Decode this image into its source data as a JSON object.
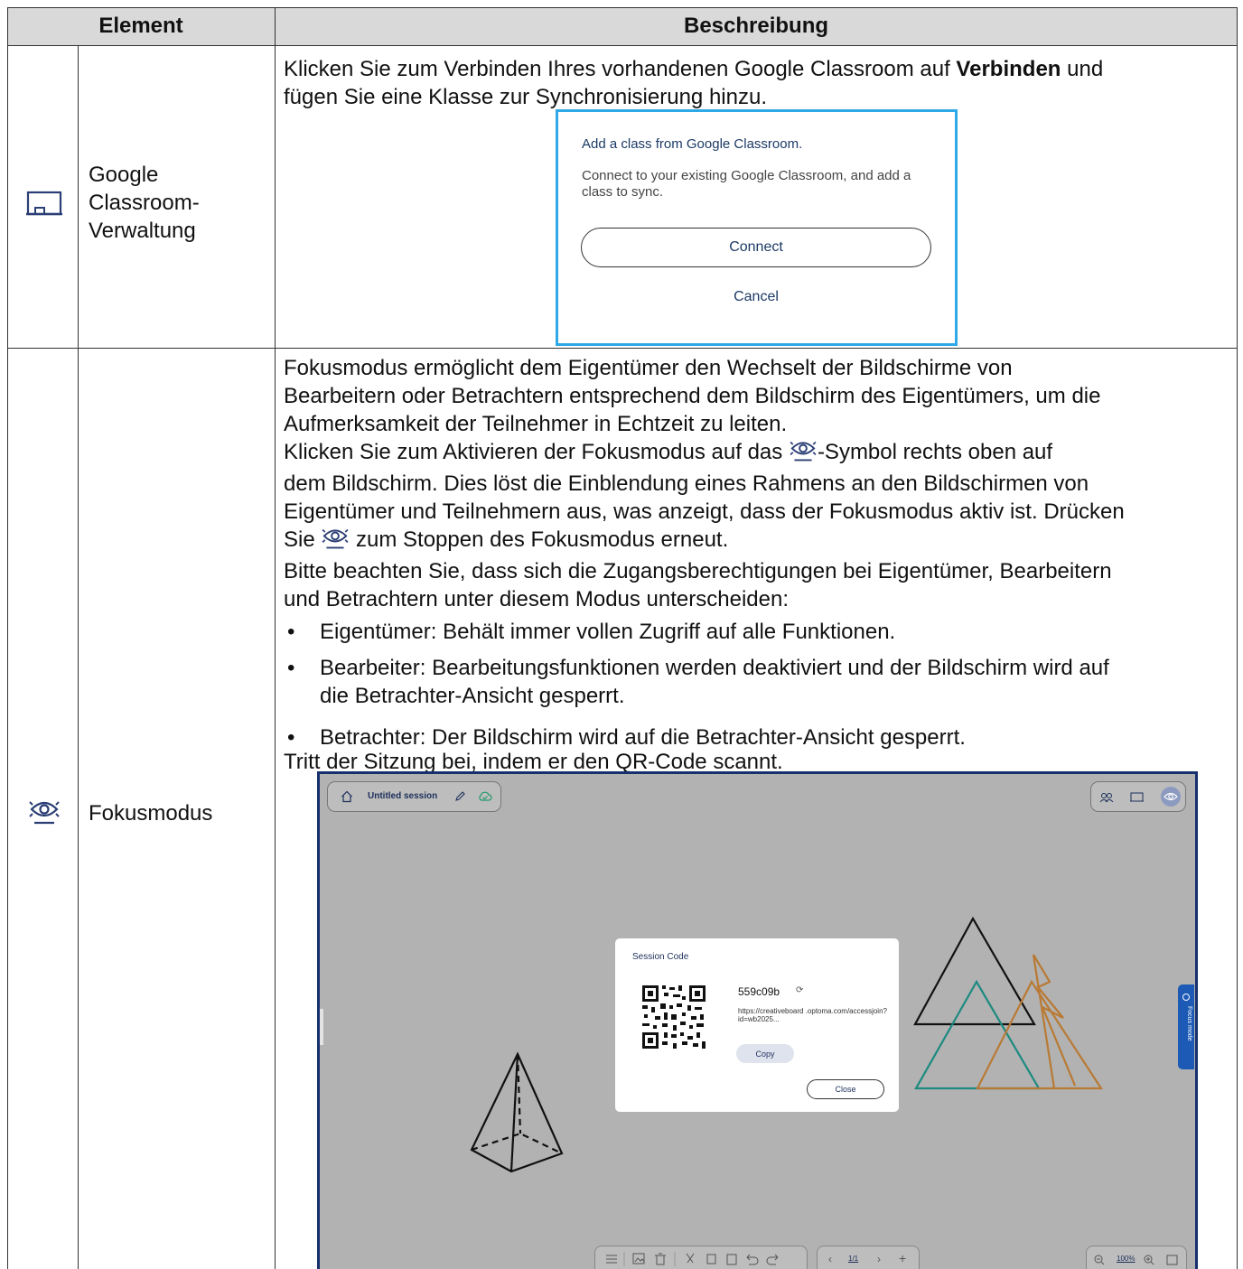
{
  "table": {
    "header": {
      "element": "Element",
      "description": "Beschreibung"
    },
    "rows": [
      {
        "icon": "classroom-icon",
        "name": "Google Classroom-Verwaltung",
        "name_lines": [
          "Google",
          "Classroom-",
          "Verwaltung"
        ],
        "text_before_bold": "Klicken Sie zum Verbinden Ihres vorhandenen Google Classroom auf ",
        "bold": "Verbinden",
        "text_after_bold": " und",
        "line2": "fügen Sie eine Klasse zur Synchronisierung hinzu."
      },
      {
        "icon": "focus-mode-icon",
        "name": "Fokusmodus",
        "para1": [
          "Fokusmodus ermöglicht dem Eigentümer den Wechselt der Bildschirme von",
          "Bearbeitern oder Betrachtern entsprechend dem Bildschirm des Eigentümers, um die",
          "Aufmerksamkeit der Teilnehmer in Echtzeit zu leiten."
        ],
        "para2_start": "Klicken Sie zum Aktivieren der Fokusmodus auf das ",
        "para2_after_icon": "-Symbol rechts oben auf",
        "para2_lines": [
          "dem Bildschirm. Dies löst die Einblendung eines Rahmens an den Bildschirmen von",
          "Eigentümer und Teilnehmern aus, was anzeigt, dass der Fokusmodus aktiv ist. Drücken"
        ],
        "para2_sie": "Sie ",
        "para2_end": " zum Stoppen des Fokusmodus erneut.",
        "para3": [
          "Bitte beachten Sie, dass sich die Zugangsberechtigungen bei Eigentümer, Bearbeitern",
          "und Betrachtern unter diesem Modus unterscheiden:"
        ],
        "bullets": [
          [
            "Eigentümer: Behält immer vollen Zugriff auf alle Funktionen."
          ],
          [
            "Bearbeiter: Bearbeitungsfunktionen werden deaktiviert und der Bildschirm wird auf",
            "die Betrachter-Ansicht gesperrt."
          ],
          [
            "Betrachter: Der Bildschirm wird auf die Betrachter-Ansicht gesperrt."
          ]
        ],
        "bullet_char": "•",
        "last_line": "Tritt der Sitzung bei, indem er den QR-Code scannt."
      }
    ]
  },
  "gc_dialog": {
    "title": "Add a class from Google Classroom.",
    "desc": "Connect to your existing Google Classroom, and add a class to sync.",
    "connect": "Connect",
    "cancel": "Cancel",
    "border_color": "#2ea8e6"
  },
  "whiteboard": {
    "session_title": "Untitled session",
    "side_tab_label": "Focus mode",
    "session_dialog": {
      "title": "Session Code",
      "code": "559c09b",
      "url": "https://creativeboard .optoma.com/accessjoin?id=wb2025...",
      "copy": "Copy",
      "close": "Close"
    },
    "page_indicator": "1/1",
    "zoom": "100%",
    "frame_color": "#16306e",
    "tab_color": "#1d5ab5"
  }
}
